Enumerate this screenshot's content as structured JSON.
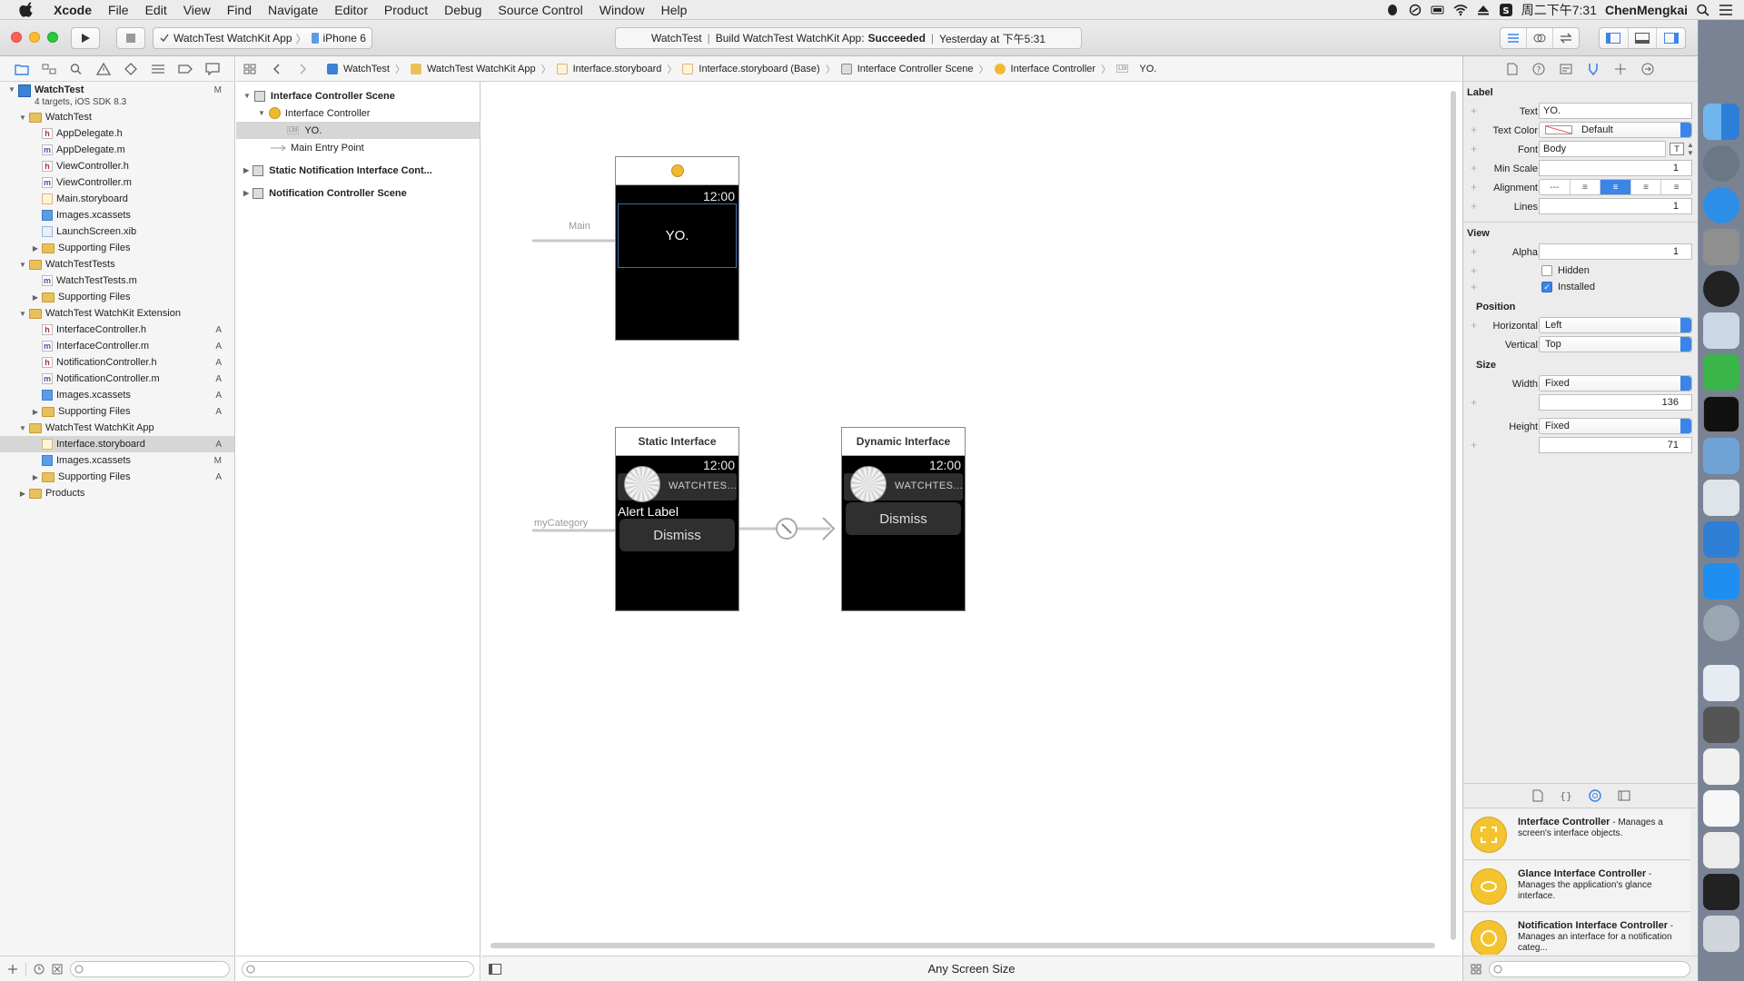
{
  "menubar": {
    "app": "Xcode",
    "menus": [
      "File",
      "Edit",
      "View",
      "Find",
      "Navigate",
      "Editor",
      "Product",
      "Debug",
      "Source Control",
      "Window",
      "Help"
    ],
    "clock": "周二下午7:31",
    "user": "ChenMengkai"
  },
  "toolbar": {
    "scheme": "WatchTest WatchKit App",
    "device": "iPhone 6",
    "activity_project": "WatchTest",
    "activity_prefix": "Build WatchTest WatchKit App:",
    "activity_status": "Succeeded",
    "activity_time": "Yesterday at 下午5:31"
  },
  "navigator": {
    "project": {
      "name": "WatchTest",
      "subtitle": "4 targets, iOS SDK 8.3",
      "badge": "M"
    },
    "rows": [
      {
        "label": "WatchTest",
        "type": "folder",
        "level": 1,
        "disclosure": "open",
        "badge": ""
      },
      {
        "label": "AppDelegate.h",
        "type": "h",
        "level": 2,
        "disclosure": "",
        "badge": ""
      },
      {
        "label": "AppDelegate.m",
        "type": "m",
        "level": 2,
        "disclosure": "",
        "badge": ""
      },
      {
        "label": "ViewController.h",
        "type": "h",
        "level": 2,
        "disclosure": "",
        "badge": ""
      },
      {
        "label": "ViewController.m",
        "type": "m",
        "level": 2,
        "disclosure": "",
        "badge": ""
      },
      {
        "label": "Main.storyboard",
        "type": "storyboard",
        "level": 2,
        "disclosure": "",
        "badge": ""
      },
      {
        "label": "Images.xcassets",
        "type": "xcassets",
        "level": 2,
        "disclosure": "",
        "badge": ""
      },
      {
        "label": "LaunchScreen.xib",
        "type": "xib",
        "level": 2,
        "disclosure": "",
        "badge": ""
      },
      {
        "label": "Supporting Files",
        "type": "folder",
        "level": 2,
        "disclosure": "closed",
        "badge": ""
      },
      {
        "label": "WatchTestTests",
        "type": "folder",
        "level": 1,
        "disclosure": "open",
        "badge": ""
      },
      {
        "label": "WatchTestTests.m",
        "type": "m",
        "level": 2,
        "disclosure": "",
        "badge": ""
      },
      {
        "label": "Supporting Files",
        "type": "folder",
        "level": 2,
        "disclosure": "closed",
        "badge": ""
      },
      {
        "label": "WatchTest WatchKit Extension",
        "type": "folder",
        "level": 1,
        "disclosure": "open",
        "badge": ""
      },
      {
        "label": "InterfaceController.h",
        "type": "h",
        "level": 2,
        "disclosure": "",
        "badge": "A"
      },
      {
        "label": "InterfaceController.m",
        "type": "m",
        "level": 2,
        "disclosure": "",
        "badge": "A"
      },
      {
        "label": "NotificationController.h",
        "type": "h",
        "level": 2,
        "disclosure": "",
        "badge": "A"
      },
      {
        "label": "NotificationController.m",
        "type": "m",
        "level": 2,
        "disclosure": "",
        "badge": "A"
      },
      {
        "label": "Images.xcassets",
        "type": "xcassets",
        "level": 2,
        "disclosure": "",
        "badge": "A"
      },
      {
        "label": "Supporting Files",
        "type": "folder",
        "level": 2,
        "disclosure": "closed",
        "badge": "A"
      },
      {
        "label": "WatchTest WatchKit App",
        "type": "folder",
        "level": 1,
        "disclosure": "open",
        "badge": ""
      },
      {
        "label": "Interface.storyboard",
        "type": "storyboard",
        "level": 2,
        "disclosure": "",
        "badge": "A",
        "selected": true
      },
      {
        "label": "Images.xcassets",
        "type": "xcassets",
        "level": 2,
        "disclosure": "",
        "badge": "M"
      },
      {
        "label": "Supporting Files",
        "type": "folder",
        "level": 2,
        "disclosure": "closed",
        "badge": "A"
      },
      {
        "label": "Products",
        "type": "folder",
        "level": 1,
        "disclosure": "closed",
        "badge": ""
      }
    ]
  },
  "jumpbar": [
    "WatchTest",
    "WatchTest WatchKit App",
    "Interface.storyboard",
    "Interface.storyboard (Base)",
    "Interface Controller Scene",
    "Interface Controller",
    "YO."
  ],
  "outline": {
    "scene1": "Interface Controller Scene",
    "controller": "Interface Controller",
    "label_item": "YO.",
    "entry": "Main Entry Point",
    "scene2": "Static Notification Interface Cont...",
    "scene3": "Notification Controller Scene"
  },
  "canvas": {
    "main_entry": "Main",
    "time": "12:00",
    "yo_label": "YO.",
    "static_title": "Static Interface",
    "dynamic_title": "Dynamic Interface",
    "category": "myCategory",
    "app_name": "WATCHTES...",
    "alert_label": "Alert Label",
    "dismiss": "Dismiss",
    "size_class": "Any Screen Size"
  },
  "inspector": {
    "label_section": "Label",
    "text_label": "Text",
    "text_value": "YO.",
    "text_color_label": "Text Color",
    "text_color_value": "Default",
    "font_label": "Font",
    "font_value": "Body",
    "font_button": "T",
    "min_scale_label": "Min Scale",
    "min_scale_value": "1",
    "alignment_label": "Alignment",
    "lines_label": "Lines",
    "lines_value": "1",
    "view_section": "View",
    "alpha_label": "Alpha",
    "alpha_value": "1",
    "hidden_label": "Hidden",
    "installed_label": "Installed",
    "position_section": "Position",
    "horizontal_label": "Horizontal",
    "horizontal_value": "Left",
    "vertical_label": "Vertical",
    "vertical_value": "Top",
    "size_section": "Size",
    "width_label": "Width",
    "width_mode": "Fixed",
    "width_value": "136",
    "height_label": "Height",
    "height_mode": "Fixed",
    "height_value": "71"
  },
  "library": [
    {
      "title": "Interface Controller",
      "desc": " - Manages a screen's interface objects."
    },
    {
      "title": "Glance Interface Controller",
      "desc": " - Manages the application's glance interface."
    },
    {
      "title": "Notification Interface Controller",
      "desc": " - Manages an interface for a notification categ..."
    }
  ],
  "colors": {
    "accent": "#3b84e8",
    "controller_yellow": "#f0b92f",
    "build_succeeded": "#222222"
  }
}
